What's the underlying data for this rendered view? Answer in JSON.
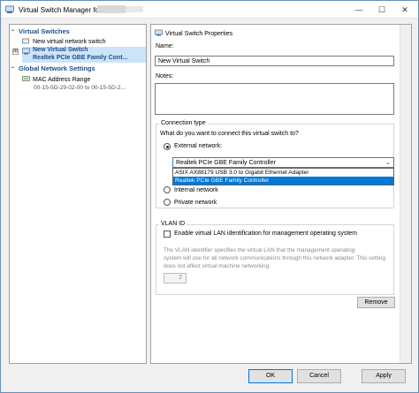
{
  "window": {
    "title": "Virtual Switch Manager for",
    "controls": {
      "minimize": "—",
      "maximize": "☐",
      "close": "✕"
    }
  },
  "tree": {
    "virtual_switches_header": "Virtual Switches",
    "new_network_switch": "New virtual network switch",
    "new_switch_name": "New Virtual Switch",
    "new_switch_adapter": "Realtek PCIe GBE Family Cont...",
    "global_settings_header": "Global Network Settings",
    "mac_range_label": "MAC Address Range",
    "mac_range_value": "00-15-5D-29-02-00 to 00-15-5D-2...",
    "expander_symbol": "⊞"
  },
  "properties": {
    "title": "Virtual Switch Properties",
    "name_label": "Name:",
    "name_value": "New Virtual Switch",
    "notes_label": "Notes:",
    "notes_value": "",
    "connection_type": {
      "legend": "Connection type",
      "question": "What do you want to connect this virtual switch to?",
      "external": "External network:",
      "internal": "Internal network",
      "private": "Private network",
      "selected_adapter": "Realtek PCIe GBE Family Controller",
      "options": [
        "ASIX AX88179 USB 3.0 to Gigabit Ethernet Adapter",
        "Realtek PCIe GBE Family Controller"
      ],
      "selected_index": 1
    },
    "vlan": {
      "legend": "VLAN ID",
      "checkbox_label": "Enable virtual LAN identification for management operating system",
      "description_1": "The VLAN identifier specifies the virtual LAN that the management operating",
      "description_2": "system will use for all network communications through this network adapter. This setting",
      "description_3": "does not affect virtual machine networking.",
      "vlan_value": "2"
    },
    "remove_button": "Remove"
  },
  "footer": {
    "ok_button": "OK",
    "cancel_button": "Cancel",
    "apply_button": "Apply"
  },
  "colors": {
    "tree_header": "#1f4e8c",
    "selection_highlight": "#0078d7",
    "selected_row": "#cce4f7"
  }
}
